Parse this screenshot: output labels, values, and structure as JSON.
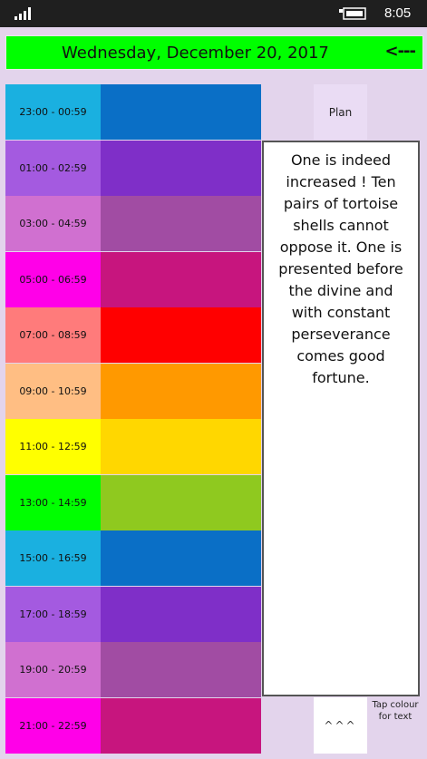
{
  "status_bar": {
    "time": "8:05"
  },
  "header": {
    "date": "Wednesday, December 20, 2017",
    "back_label": "<---"
  },
  "rows": [
    {
      "time": "23:00 - 00:59",
      "label_color": "#1ab0e0",
      "block_color": "#0a6fc6"
    },
    {
      "time": "01:00 - 02:59",
      "label_color": "#a45ae0",
      "block_color": "#7f2fc8"
    },
    {
      "time": "03:00 - 04:59",
      "label_color": "#d070d0",
      "block_color": "#a14ca3"
    },
    {
      "time": "05:00 - 06:59",
      "label_color": "#ff00e8",
      "block_color": "#c7157e"
    },
    {
      "time": "07:00 - 08:59",
      "label_color": "#ff7b7b",
      "block_color": "#ff0000"
    },
    {
      "time": "09:00 - 10:59",
      "label_color": "#ffbe83",
      "block_color": "#ff9900"
    },
    {
      "time": "11:00 - 12:59",
      "label_color": "#ffff00",
      "block_color": "#ffd700"
    },
    {
      "time": "13:00 - 14:59",
      "label_color": "#00ff00",
      "block_color": "#8fc91f"
    },
    {
      "time": "15:00 - 16:59",
      "label_color": "#1ab0e0",
      "block_color": "#0a6fc6"
    },
    {
      "time": "17:00 - 18:59",
      "label_color": "#a45ae0",
      "block_color": "#7f2fc8"
    },
    {
      "time": "19:00 - 20:59",
      "label_color": "#d070d0",
      "block_color": "#a14ca3"
    },
    {
      "time": "21:00 - 22:59",
      "label_color": "#ff00e8",
      "block_color": "#c7157e"
    }
  ],
  "plan_label": "Plan",
  "oracle_text": "One is indeed increased ! Ten pairs of tortoise shells cannot oppose it. One is presented before the divine and with constant perseverance comes good fortune.",
  "scroll_label": "^^^",
  "hint": "Tap colour for text"
}
